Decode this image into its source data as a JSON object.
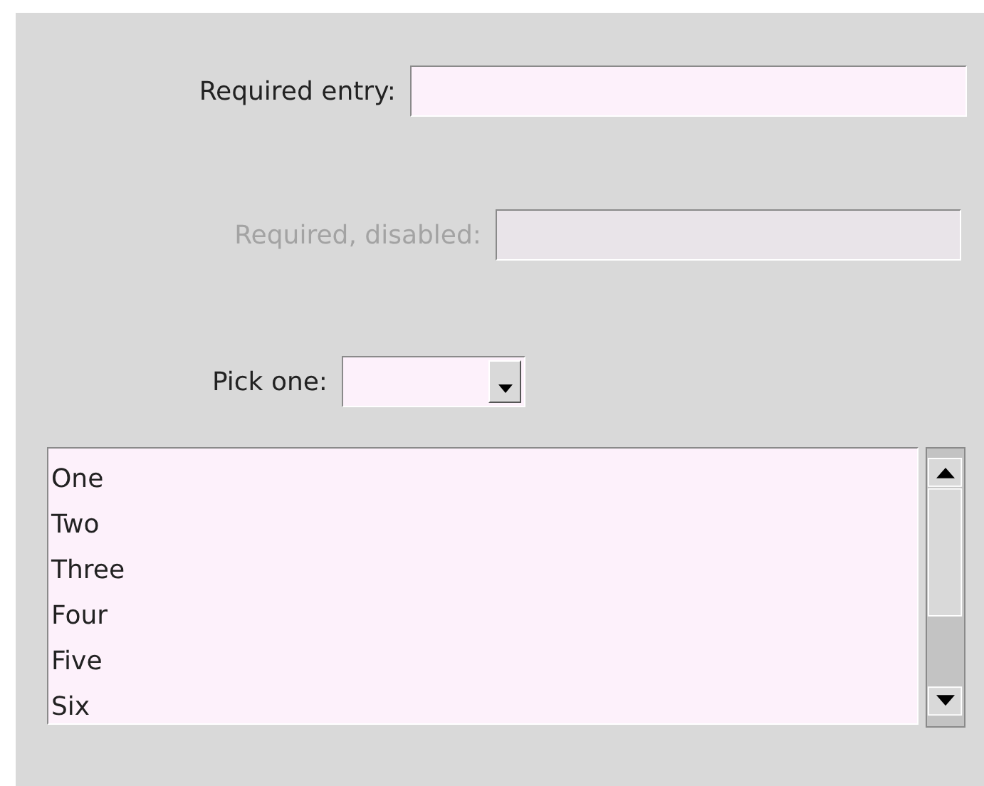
{
  "form": [
    {
      "kind": "entry",
      "label": "Required entry:",
      "disabled": false
    },
    {
      "kind": "entry",
      "label": "Required, disabled:",
      "disabled": true
    },
    {
      "kind": "combobox",
      "label": "Pick one:",
      "disabled": false
    }
  ],
  "listbox": {
    "items": [
      "One",
      "Two",
      "Three",
      "Four",
      "Five",
      "Six"
    ]
  }
}
